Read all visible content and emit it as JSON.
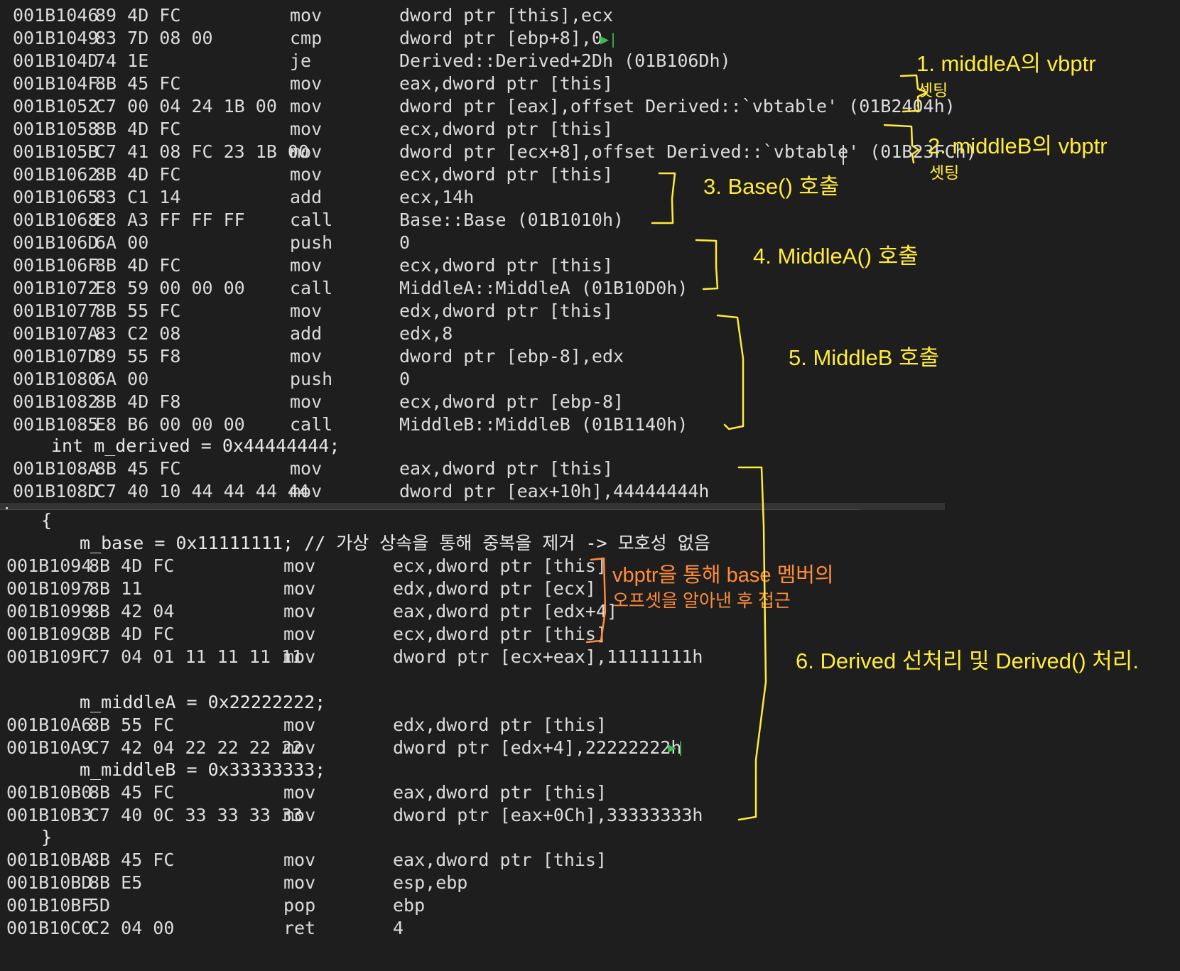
{
  "top_rows": [
    {
      "addr": "001B1046",
      "bytes": "89 4D FC",
      "mn": "mov",
      "op": "dword ptr [this],ecx"
    },
    {
      "addr": "001B1049",
      "bytes": "83 7D 08 00",
      "mn": "cmp",
      "op": "dword ptr [ebp+8],0"
    },
    {
      "addr": "001B104D",
      "bytes": "74 1E",
      "mn": "je",
      "op": "Derived::Derived+2Dh (01B106Dh)"
    },
    {
      "addr": "001B104F",
      "bytes": "8B 45 FC",
      "mn": "mov",
      "op": "eax,dword ptr [this]"
    },
    {
      "addr": "001B1052",
      "bytes": "C7 00 04 24 1B 00",
      "mn": "mov",
      "op": "dword ptr [eax],offset Derived::`vbtable' (01B2404h)"
    },
    {
      "addr": "001B1058",
      "bytes": "8B 4D FC",
      "mn": "mov",
      "op": "ecx,dword ptr [this]"
    },
    {
      "addr": "001B105B",
      "bytes": "C7 41 08 FC 23 1B 00",
      "mn": "mov",
      "op": "dword ptr [ecx+8],offset Derived::`vbtable' (01B23FCh)"
    },
    {
      "addr": "001B1062",
      "bytes": "8B 4D FC",
      "mn": "mov",
      "op": "ecx,dword ptr [this]"
    },
    {
      "addr": "001B1065",
      "bytes": "83 C1 14",
      "mn": "add",
      "op": "ecx,14h"
    },
    {
      "addr": "001B1068",
      "bytes": "E8 A3 FF FF FF",
      "mn": "call",
      "op": "Base::Base (01B1010h)"
    },
    {
      "addr": "001B106D",
      "bytes": "6A 00",
      "mn": "push",
      "op": "0"
    },
    {
      "addr": "001B106F",
      "bytes": "8B 4D FC",
      "mn": "mov",
      "op": "ecx,dword ptr [this]"
    },
    {
      "addr": "001B1072",
      "bytes": "E8 59 00 00 00",
      "mn": "call",
      "op": "MiddleA::MiddleA (01B10D0h)"
    },
    {
      "addr": "001B1077",
      "bytes": "8B 55 FC",
      "mn": "mov",
      "op": "edx,dword ptr [this]"
    },
    {
      "addr": "001B107A",
      "bytes": "83 C2 08",
      "mn": "add",
      "op": "edx,8"
    },
    {
      "addr": "001B107D",
      "bytes": "89 55 F8",
      "mn": "mov",
      "op": "dword ptr [ebp-8],edx"
    },
    {
      "addr": "001B1080",
      "bytes": "6A 00",
      "mn": "push",
      "op": "0"
    },
    {
      "addr": "001B1082",
      "bytes": "8B 4D F8",
      "mn": "mov",
      "op": "ecx,dword ptr [ebp-8]"
    },
    {
      "addr": "001B1085",
      "bytes": "E8 B6 00 00 00",
      "mn": "call",
      "op": "MiddleB::MiddleB (01B1140h)"
    }
  ],
  "top_source": "int m_derived = 0x44444444;",
  "top_rows2": [
    {
      "addr": "001B108A",
      "bytes": "8B 45 FC",
      "mn": "mov",
      "op": "eax,dword ptr [this]"
    },
    {
      "addr": "001B108D",
      "bytes": "C7 40 10 44 44 44 44",
      "mn": "mov",
      "op": "dword ptr [eax+10h],44444444h"
    }
  ],
  "bottom": {
    "brace_open": "{",
    "src_base": "m_base = 0x11111111; // 가상 상속을 통해 중복을 제거 -> 모호성 없음",
    "rows_base": [
      {
        "addr": "001B1094",
        "bytes": "8B 4D FC",
        "mn": "mov",
        "op": "ecx,dword ptr [this]"
      },
      {
        "addr": "001B1097",
        "bytes": "8B 11",
        "mn": "mov",
        "op": "edx,dword ptr [ecx]"
      },
      {
        "addr": "001B1099",
        "bytes": "8B 42 04",
        "mn": "mov",
        "op": "eax,dword ptr [edx+4]"
      },
      {
        "addr": "001B109C",
        "bytes": "8B 4D FC",
        "mn": "mov",
        "op": "ecx,dword ptr [this]"
      },
      {
        "addr": "001B109F",
        "bytes": "C7 04 01 11 11 11 11",
        "mn": "mov",
        "op": "dword ptr [ecx+eax],11111111h"
      }
    ],
    "src_middleA": "m_middleA = 0x22222222;",
    "rows_middleA": [
      {
        "addr": "001B10A6",
        "bytes": "8B 55 FC",
        "mn": "mov",
        "op": "edx,dword ptr [this]"
      },
      {
        "addr": "001B10A9",
        "bytes": "C7 42 04 22 22 22 22",
        "mn": "mov",
        "op": "dword ptr [edx+4],22222222h"
      }
    ],
    "src_middleB": "m_middleB = 0x33333333;",
    "rows_middleB": [
      {
        "addr": "001B10B0",
        "bytes": "8B 45 FC",
        "mn": "mov",
        "op": "eax,dword ptr [this]"
      },
      {
        "addr": "001B10B3",
        "bytes": "C7 40 0C 33 33 33 33",
        "mn": "mov",
        "op": "dword ptr [eax+0Ch],33333333h"
      }
    ],
    "brace_close": "}",
    "rows_end": [
      {
        "addr": "001B10BA",
        "bytes": "8B 45 FC",
        "mn": "mov",
        "op": "eax,dword ptr [this]"
      },
      {
        "addr": "001B10BD",
        "bytes": "8B E5",
        "mn": "mov",
        "op": "esp,ebp"
      },
      {
        "addr": "001B10BF",
        "bytes": "5D",
        "mn": "pop",
        "op": "ebp"
      },
      {
        "addr": "001B10C0",
        "bytes": "C2 04 00",
        "mn": "ret",
        "op": "4"
      }
    ]
  },
  "annotations": {
    "a1_title": "1. middleA의 vbptr",
    "a1_sub": "셋팅",
    "a2_title": "2. middleB의 vbptr",
    "a2_sub": "셋팅",
    "a3": "3. Base() 호출",
    "a4": "4. MiddleA() 호출",
    "a5": "5. MiddleB 호출",
    "a6": "6. Derived 선처리 및 Derived() 처리.",
    "orange_line1": "vbptr을 통해 base 멤버의",
    "orange_line2": "오프셋을 알아낸 후 접근"
  },
  "icons": {
    "breakpoint_arrow": "play-next-icon"
  },
  "colors": {
    "background": "#1e1e1e",
    "text": "#dcdcdc",
    "yellow": "#ffeb3b",
    "orange": "#ff8c3b",
    "green": "#3dbb4a"
  }
}
